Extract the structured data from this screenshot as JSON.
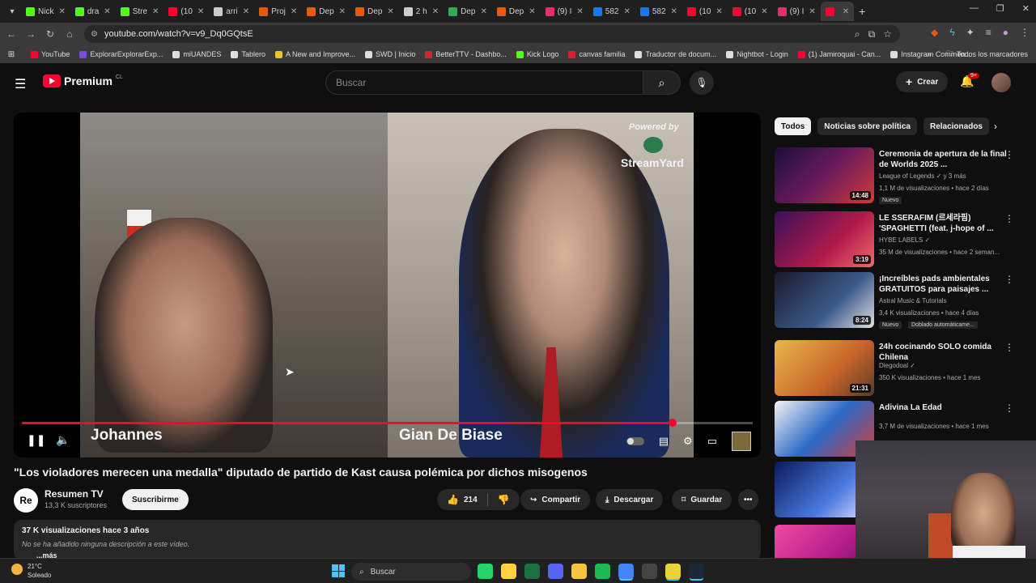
{
  "browser": {
    "tabs": [
      {
        "label": "Nick",
        "color": "#53fc18"
      },
      {
        "label": "dra",
        "color": "#53fc18"
      },
      {
        "label": "Stre",
        "color": "#53fc18"
      },
      {
        "label": "(10",
        "color": "#ff0033"
      },
      {
        "label": "arri",
        "color": "#cccccc"
      },
      {
        "label": "Proj",
        "color": "#e8590c"
      },
      {
        "label": "Dep",
        "color": "#e8590c"
      },
      {
        "label": "Dep",
        "color": "#e8590c"
      },
      {
        "label": "2 h",
        "color": "#cccccc"
      },
      {
        "label": "Dep",
        "color": "#34a853"
      },
      {
        "label": "Dep",
        "color": "#e8590c"
      },
      {
        "label": "(9) I",
        "color": "#e1306c"
      },
      {
        "label": "582",
        "color": "#1877f2"
      },
      {
        "label": "582",
        "color": "#1877f2"
      },
      {
        "label": "(10",
        "color": "#ff0033"
      },
      {
        "label": "(10",
        "color": "#ff0033"
      },
      {
        "label": "(9) I",
        "color": "#e1306c"
      },
      {
        "label": "",
        "color": "#ff0033",
        "active": true
      }
    ],
    "url": "youtube.com/watch?v=v9_Dq0GQtsE",
    "bookmarks": [
      {
        "label": "YouTube",
        "color": "#ff0033"
      },
      {
        "label": "ExplorarExplorarExp...",
        "color": "#7b4ce0"
      },
      {
        "label": "miUANDES",
        "color": "#dddddd"
      },
      {
        "label": "Tablero",
        "color": "#dddddd"
      },
      {
        "label": "A New and Improve...",
        "color": "#e8c33a"
      },
      {
        "label": "SWD | Inicio",
        "color": "#dddddd"
      },
      {
        "label": "BetterTTV - Dashbo...",
        "color": "#d9202a"
      },
      {
        "label": "Kick Logo",
        "color": "#53fc18"
      },
      {
        "label": "canvas familia",
        "color": "#d9202a"
      },
      {
        "label": "Traductor de docum...",
        "color": "#dddddd"
      },
      {
        "label": "Nightbot - Login",
        "color": "#dddddd"
      },
      {
        "label": "(1) Jamiroquai - Can...",
        "color": "#ff0033"
      },
      {
        "label": "Instagram Commen...",
        "color": "#dddddd"
      }
    ],
    "bookmarks_all": "Todos los marcadores"
  },
  "youtube": {
    "logo": "Premium",
    "country": "CL",
    "search_placeholder": "Buscar",
    "create_label": "Crear",
    "notif_count": "9+"
  },
  "player": {
    "powered_by": "Powered by",
    "streamyard": "StreamYard",
    "name_left": "Johannes",
    "name_right": "Gian De Biase",
    "progress": 0.89
  },
  "video": {
    "title": "\"Los violadores merecen una medalla\" diputado de partido de Kast causa polémica por dichos misogenos",
    "channel_initials": "Re",
    "channel_name": "Resumen TV",
    "subscribers": "13,3 K suscriptores",
    "subscribe_label": "Suscribirme",
    "likes": "214",
    "share_label": "Compartir",
    "download_label": "Descargar",
    "save_label": "Guardar",
    "views_date": "37 K visualizaciones  hace 3 años",
    "no_description": "No se ha añadido ninguna descripción a este vídeo.",
    "more_label": "...más"
  },
  "sidebar": {
    "chips": [
      "Todos",
      "Noticias sobre política",
      "Relacionados"
    ],
    "recs": [
      {
        "title": "Ceremonia de apertura de la final de Worlds 2025 ...",
        "channel": "League of Legends",
        "meta": "1,1 M de visualizaciones • hace 2 días",
        "extra_c": "✓ y 3 más",
        "badge": "Nuevo",
        "duration": "14:48",
        "thumb": "linear-gradient(135deg,#1a0f3a,#6a1a5a 50%,#d23a3a)"
      },
      {
        "title": "LE SSERAFIM (르세라핌) 'SPAGHETTI (feat. j-hope of ...",
        "channel": "HYBE LABELS",
        "meta": "35 M de visualizaciones • hace 2 seman...",
        "extra_c": "✓",
        "badge": "",
        "duration": "3:19",
        "thumb": "linear-gradient(135deg,#3a0f5a,#b01a4a 60%,#f06a6a)"
      },
      {
        "title": "¡Increíbles pads ambientales GRATUITOS para paisajes ...",
        "channel": "Astral Music & Tutorials",
        "meta": "3,4 K visualizaciones • hace 4 días",
        "extra_c": "",
        "badge": "Nuevo",
        "badge2": "Doblado automáticame...",
        "duration": "8:24",
        "thumb": "linear-gradient(135deg,#1a1a2a,#3a5a8a 60%,#e0e0e0)"
      },
      {
        "title": "24h cocinando SOLO comida Chilena",
        "channel": "Diegodoal",
        "meta": "350 K visualizaciones • hace 1 mes",
        "extra_c": "✓",
        "badge": "",
        "duration": "21:31",
        "thumb": "linear-gradient(135deg,#e8b84a,#c8642a 60%,#5a3a2a)"
      },
      {
        "title": "Adivina La Edad",
        "channel": "",
        "meta": "3,7 M de visualizaciones • hace 1 mes",
        "extra_c": "",
        "badge": "",
        "duration": "",
        "thumb": "linear-gradient(135deg,#f4f4f4,#2a6ac8 50%,#d23a3a)"
      },
      {
        "title": "",
        "channel": "",
        "meta": "",
        "extra_c": "",
        "badge": "",
        "duration": "",
        "thumb": "linear-gradient(135deg,#0a1a5a,#4a7ae0 60%,#e8e0ff)"
      },
      {
        "title": "",
        "channel": "",
        "meta": "",
        "extra_c": "",
        "badge": "",
        "duration": "",
        "thumb": "linear-gradient(135deg,#f04aa0,#b01a8a 60%,#3a1a5a)"
      }
    ]
  },
  "taskbar": {
    "temp": "21°C",
    "condition": "Soleado",
    "search_placeholder": "Buscar",
    "apps": [
      {
        "name": "whatsapp",
        "color": "#25d366"
      },
      {
        "name": "notepad",
        "color": "#ffd33d"
      },
      {
        "name": "excel",
        "color": "#1d6f42"
      },
      {
        "name": "discord",
        "color": "#5865f2"
      },
      {
        "name": "explorer",
        "color": "#f5c542"
      },
      {
        "name": "spotify",
        "color": "#1db954"
      },
      {
        "name": "chrome",
        "color": "#4285f4",
        "active": true
      },
      {
        "name": "obs",
        "color": "#444444"
      },
      {
        "name": "sticky",
        "color": "#e8d43a",
        "active": true
      },
      {
        "name": "steam",
        "color": "#1b2838",
        "active": true
      }
    ]
  }
}
